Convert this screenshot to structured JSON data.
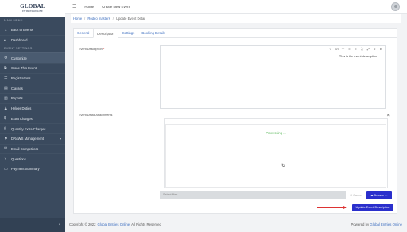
{
  "logo": {
    "main": "GLOBAL",
    "sub": "ENTRIES ONLINE"
  },
  "sidebar": {
    "main_menu_heading": "MAIN MENU",
    "main_items": [
      {
        "label": "Back to Events",
        "icon": "arrow-left-icon"
      },
      {
        "label": "Dashboard",
        "icon": "dashboard-icon"
      }
    ],
    "settings_heading": "EVENT SETTINGS",
    "settings_items": [
      {
        "label": "Customize",
        "icon": "gear-icon",
        "active": true
      },
      {
        "label": "Clone This Event",
        "icon": "clone-icon"
      },
      {
        "label": "Registrations",
        "icon": "registrations-icon"
      },
      {
        "label": "Classes",
        "icon": "classes-icon"
      },
      {
        "label": "Reports",
        "icon": "reports-icon"
      },
      {
        "label": "Helper Duties",
        "icon": "helper-icon"
      },
      {
        "label": "Extra Charges",
        "icon": "charges-icon"
      },
      {
        "label": "Quantity Extra Charges",
        "icon": "quantity-icon"
      },
      {
        "label": "DRAWS Management",
        "icon": "draws-icon",
        "caret": "▾"
      },
      {
        "label": "Email Competitors",
        "icon": "email-icon"
      },
      {
        "label": "Questions",
        "icon": "questions-icon"
      },
      {
        "label": "Payment Summary",
        "icon": "payment-icon"
      }
    ],
    "collapse_glyph": "‹"
  },
  "topbar": {
    "menu_glyph": "☰",
    "home": "Home",
    "create": "Create New Event"
  },
  "breadcrumb": {
    "home": "Home",
    "section": "Rodeo masters",
    "current": "Update Event Detail"
  },
  "tabs": [
    {
      "label": "General",
      "active": false
    },
    {
      "label": "Description",
      "active": true
    },
    {
      "label": "Settings",
      "active": false
    },
    {
      "label": "Booking Details",
      "active": false
    }
  ],
  "form": {
    "description_label": "Event Description",
    "required_mark": "*",
    "editor_toolbar": [
      "?",
      "</>",
      "⋯",
      "≡",
      "≡",
      "⛶",
      "⤢",
      "♪",
      "B"
    ],
    "editor_text": "This is the event description",
    "attachments_label": "Event Detail Attachments",
    "close_glyph": "×",
    "processing_text": "Processing ...",
    "file_placeholder": "Select files...",
    "cancel_label": "Cancel",
    "browse_label": "Browse ...",
    "update_label": "Update Event Description"
  },
  "footer": {
    "prefix": "Copyright © 2022",
    "brand": "Global Entries Online",
    "rights": "All Rights Reserved",
    "powered": "Powered by",
    "powered_brand": "Global Entries Online"
  },
  "colors": {
    "sidebar": "#3a4a5e",
    "accent": "#2a2fcc",
    "link": "#3b6dbf",
    "annotation_arrow": "#dd3333"
  }
}
